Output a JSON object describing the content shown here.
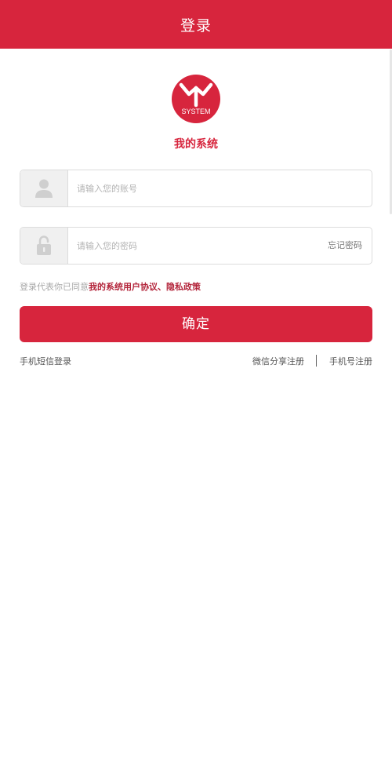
{
  "header": {
    "title": "登录"
  },
  "logo": {
    "text": "SYSTEM",
    "color": "#d7253d"
  },
  "app_name": "我的系统",
  "account": {
    "placeholder": "请输入您的账号",
    "value": "",
    "icon": "user-icon"
  },
  "password": {
    "placeholder": "请输入您的密码",
    "value": "",
    "icon": "lock-icon",
    "forgot_label": "忘记密码"
  },
  "agreement": {
    "prefix": "登录代表你已同意",
    "link": "我的系统用户协议、隐私政策"
  },
  "confirm_label": "确定",
  "links": {
    "sms_login": "手机短信登录",
    "wechat_register": "微信分享注册",
    "phone_register": "手机号注册"
  },
  "colors": {
    "accent": "#d7253d",
    "link": "#b3243a"
  }
}
